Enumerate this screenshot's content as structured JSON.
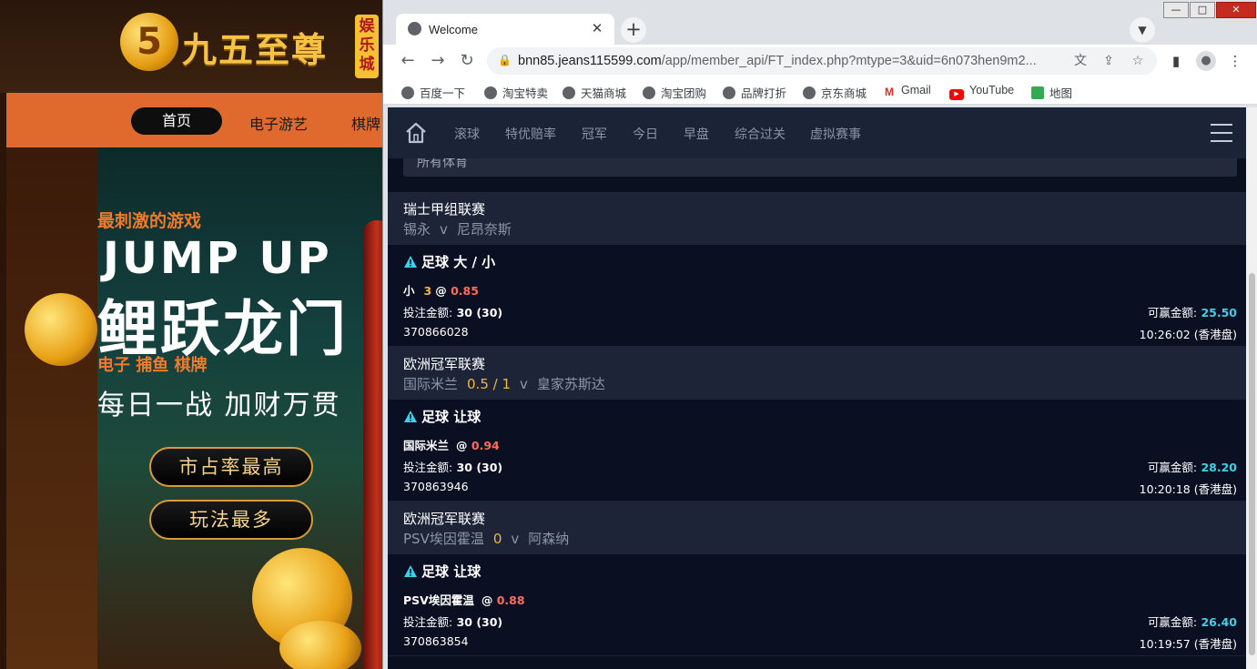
{
  "background_site": {
    "logo_text": "九五至尊",
    "logo_badge": "娱乐城",
    "nav": {
      "home": "首页",
      "items": [
        "电子游艺",
        "棋牌"
      ]
    },
    "banner": {
      "subtitle": "最刺激的游戏",
      "headline_en": "JUMP UP",
      "headline_cn": "鲤跃龙门",
      "categories": "电子  捕鱼  棋牌",
      "slogan": "每日一战 加财万贯",
      "buttons": [
        "市占率最高",
        "玩法最多"
      ]
    }
  },
  "browser": {
    "tab_title": "Welcome",
    "url_host": "bnn85.jeans115599.com",
    "url_rest": "/app/member_api/FT_index.php?mtype=3&uid=6n073hen9m2...",
    "bookmarks": [
      "百度一下",
      "淘宝特卖",
      "天猫商城",
      "淘宝团购",
      "品牌打折",
      "京东商城",
      "Gmail",
      "YouTube",
      "地图"
    ],
    "window_controls": {
      "minimize": "—",
      "maximize": "□",
      "close": "✕"
    }
  },
  "app": {
    "nav_items": [
      "滚球",
      "特优赔率",
      "冠军",
      "今日",
      "早盘",
      "综合过关",
      "虚拟赛事"
    ],
    "filter_label": "所有体育",
    "labels": {
      "stake": "投注金额:",
      "win": "可赢金额:",
      "at": "@",
      "vs": "v"
    },
    "bets": [
      {
        "league": "瑞士甲组联赛",
        "home": "锡永",
        "handicap": "",
        "away": "尼昂奈斯",
        "bet_type": "足球 大 / 小",
        "pick": "小",
        "pick_line": "3",
        "odds": "0.85",
        "stake": "30 (30)",
        "win_amount": "25.50",
        "ticket_id": "370866028",
        "time": "10:26:02 (香港盘)"
      },
      {
        "league": "欧洲冠军联赛",
        "home": "国际米兰",
        "handicap": "0.5 / 1",
        "away": "皇家苏斯达",
        "bet_type": "足球 让球",
        "pick": "国际米兰",
        "pick_line": "",
        "odds": "0.94",
        "stake": "30 (30)",
        "win_amount": "28.20",
        "ticket_id": "370863946",
        "time": "10:20:18 (香港盘)"
      },
      {
        "league": "欧洲冠军联赛",
        "home": "PSV埃因霍温",
        "handicap": "0",
        "away": "阿森纳",
        "bet_type": "足球 让球",
        "pick": "PSV埃因霍温",
        "pick_line": "",
        "odds": "0.88",
        "stake": "30 (30)",
        "win_amount": "26.40",
        "ticket_id": "370863854",
        "time": "10:19:57 (香港盘)"
      }
    ]
  },
  "colors": {
    "app_bg": "#0a1020",
    "nav_bg": "#1b2337",
    "odds": "#ff6b5a",
    "handicap": "#f3b63b",
    "win_amount": "#3fd0e8",
    "warn_icon": "#3fd0e8",
    "casino_orange": "#e0692e"
  }
}
